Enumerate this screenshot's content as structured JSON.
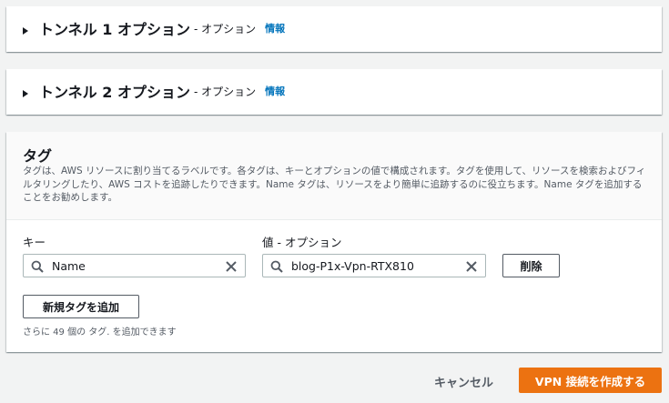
{
  "tunnel1": {
    "title": "トンネル 1 オプション",
    "suffix": "- オプション",
    "info": "情報"
  },
  "tunnel2": {
    "title": "トンネル 2 オプション",
    "suffix": "- オプション",
    "info": "情報"
  },
  "tags": {
    "title": "タグ",
    "description": "タグは、AWS リソースに割り当てるラベルです。各タグは、キーとオプションの値で構成されます。タグを使用して、リソースを検索およびフィルタリングしたり、AWS コストを追跡したりできます。Name タグは、リソースをより簡単に追跡するのに役立ちます。Name タグを追加することをお勧めします。",
    "key_label": "キー",
    "value_label": "値 - オプション",
    "key_value": "Name",
    "value_value": "blog-P1x-Vpn-RTX810",
    "remove_label": "削除",
    "add_label": "新規タグを追加",
    "hint": "さらに 49 個の タグ. を追加できます"
  },
  "footer": {
    "cancel_label": "キャンセル",
    "create_label": "VPN 接続を作成する"
  },
  "colors": {
    "primary": "#ec7211",
    "link": "#0073bb"
  }
}
